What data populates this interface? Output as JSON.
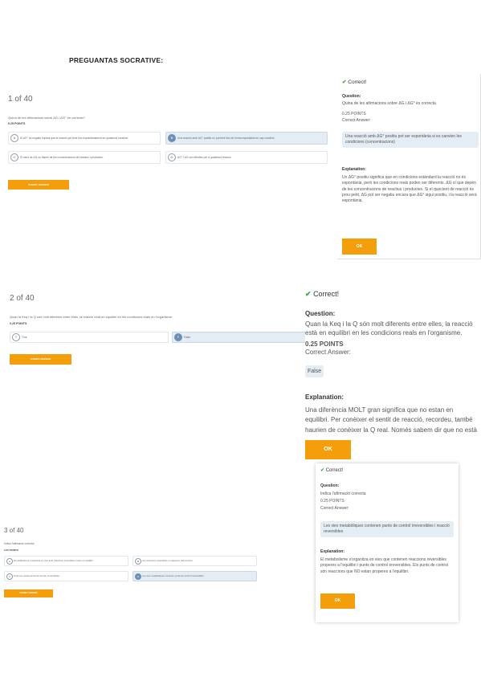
{
  "page_title": "PREGUANTAS SOCRATIVE:",
  "q1": {
    "number": "1 of 40",
    "text": "Quina de les afirmacions sobre ΔG i ΔG° és correcta?",
    "points": "0.25 POINTS",
    "options": [
      {
        "letter": "A",
        "text": "Si ΔG° és negatiu implica que la reacció pot tenir lloc espontàniament en qualsevol condició."
      },
      {
        "letter": "B",
        "text": "Una reacció amb ΔG° positiu no pot tenir lloc de forma espontània en cap condició."
      },
      {
        "letter": "C",
        "text": "El valor de ΔG no depèn de les concentracions de reactius i productes."
      },
      {
        "letter": "D",
        "text": "ΔG° i ΔG són idèntics per a qualsevol reacció."
      }
    ],
    "submit": "SUBMIT ANSWER"
  },
  "fb1": {
    "correct": "Correct!",
    "question_label": "Question:",
    "question": "Quina de les afirmacions sobre ΔG i ΔG° és correcta",
    "points": "0.25 POINTS",
    "correct_answer_label": "Correct Answer:",
    "answer": "Una reacció amb ΔG° positiu pot ser espontània si es canvien les condicions (concentracions)",
    "explanation_label": "Explanation:",
    "explanation": "Un ΔG° positiu significa que en condicions estàndard la reacció no és espontània, però les condicions reals poden ser diferents. ΔG sí que depèn de les concentracions de reactius i productes. Si el quocient de reacció és prou petit, ΔG pot ser negatiu encara que ΔG° sigui positiu, i la reacció serà espontània.",
    "ok": "OK"
  },
  "q2": {
    "number": "2 of 40",
    "text": "Quan la Keq i la Q són molt diferents entre elles, la reacció està en equilibri en les condicions reals en l'organisme.",
    "points": "0.25 POINTS",
    "options": [
      {
        "letter": "T",
        "text": "True"
      },
      {
        "letter": "F",
        "text": "False"
      }
    ],
    "submit": "SUBMIT ANSWER"
  },
  "fb2": {
    "correct": "Correct!",
    "question_label": "Question:",
    "question": "Quan la Keq i la Q són molt diferents entre elles, la reacció està en equilibri en les condicions reals en l'organisme.",
    "points": "0.25 POINTS",
    "correct_answer_label": "Correct Answer:",
    "answer": "False",
    "explanation_label": "Explanation:",
    "explanation": "Una diferència MOLT gran significa que no estan en equilibri. Per conèixer el sentit de reacció, recordeu, també haurien de conèixer la Q real. Només sabem dir que no està en equilibri.",
    "ok": "OK"
  },
  "q3": {
    "number": "3 of 40",
    "text": "Indica l'afirmació correcta:",
    "points": "0.25 POINTS",
    "options": [
      {
        "letter": "A",
        "text": "El metabolisme s'organitza en vies amb reaccions reversibles i totes en equilibri."
      },
      {
        "letter": "B",
        "text": "Les reaccions reversibles no depenen dels enzims."
      },
      {
        "letter": "C",
        "text": "Totes les reaccions d'una via són irreversibles."
      },
      {
        "letter": "D",
        "text": "Les vies metabòliques contenen punts de control irreversibles."
      }
    ],
    "submit": "SUBMIT ANSWER"
  },
  "fb3": {
    "correct": "Correct!",
    "question_label": "Question:",
    "question": "Indica l'afirmació correcta",
    "points": "0.25 POINTS",
    "correct_answer_label": "Correct Answer:",
    "answer": "Les vies metabòliques contenen punts de control irreversibles i reacció reversibles",
    "explanation_label": "Explanation:",
    "explanation": "El metabolisme s'organitza en vies que contenen reaccions reversibles properes a l'equilibri i punts de control irreversibles. Els punts de control són reaccions que NO estan properes a l'equilibri.",
    "ok": "OK"
  },
  "colors": {
    "accent": "#f59e0b",
    "selected": "#e4ecf4",
    "success": "#43a047"
  },
  "icons": {
    "correct": "check-icon"
  }
}
